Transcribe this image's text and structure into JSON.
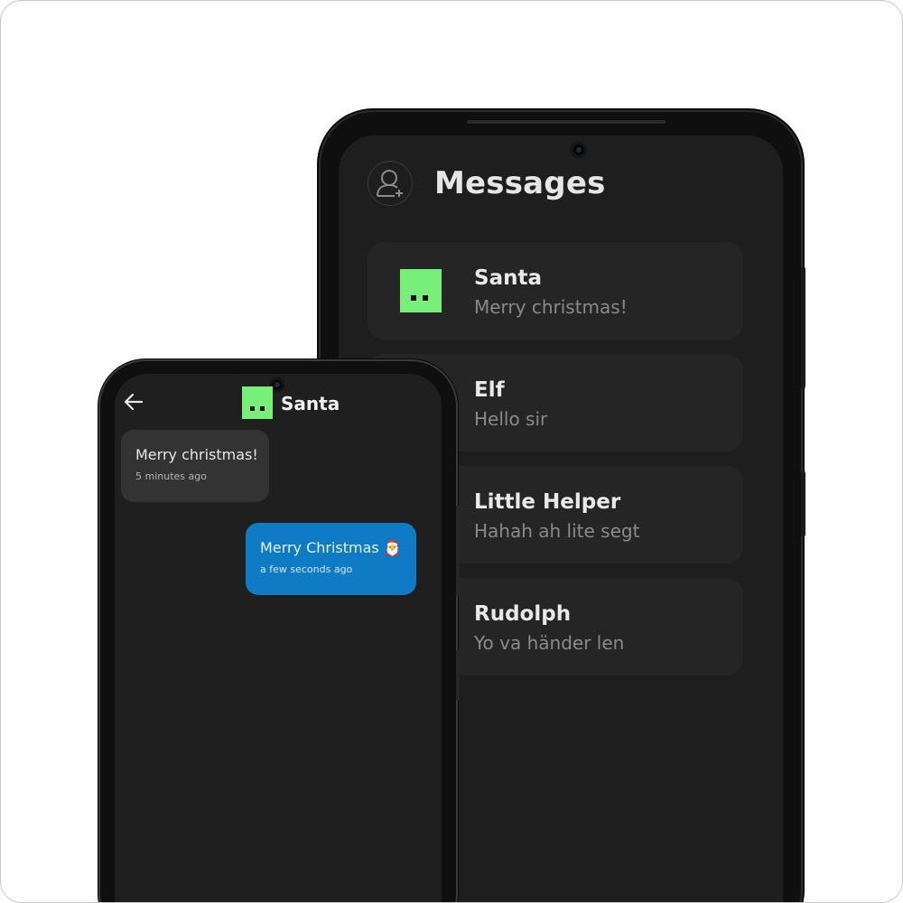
{
  "messages_list": {
    "title": "Messages",
    "conversations": [
      {
        "name": "Santa",
        "preview": "Merry christmas!",
        "has_avatar": true
      },
      {
        "name": "Elf",
        "preview": "Hello sir",
        "has_avatar": false
      },
      {
        "name": "Little Helper",
        "preview": "Hahah ah lite segt",
        "has_avatar": false
      },
      {
        "name": "Rudolph",
        "preview": "Yo va händer len",
        "has_avatar": false
      }
    ]
  },
  "chat": {
    "title": "Santa",
    "messages": [
      {
        "direction": "incoming",
        "text": "Merry christmas!",
        "time": "5 minutes ago"
      },
      {
        "direction": "outgoing",
        "text": "Merry Christmas 🎅",
        "time": "a few seconds ago"
      }
    ]
  },
  "colors": {
    "avatar": "#78ef78",
    "outgoing_bubble": "#0f7bc4",
    "incoming_bubble": "#333333",
    "screen_background": "#1e1e1e",
    "card_background": "#252525"
  },
  "icons": {
    "header": "add-user-icon",
    "chat_back": "back-arrow-icon"
  }
}
